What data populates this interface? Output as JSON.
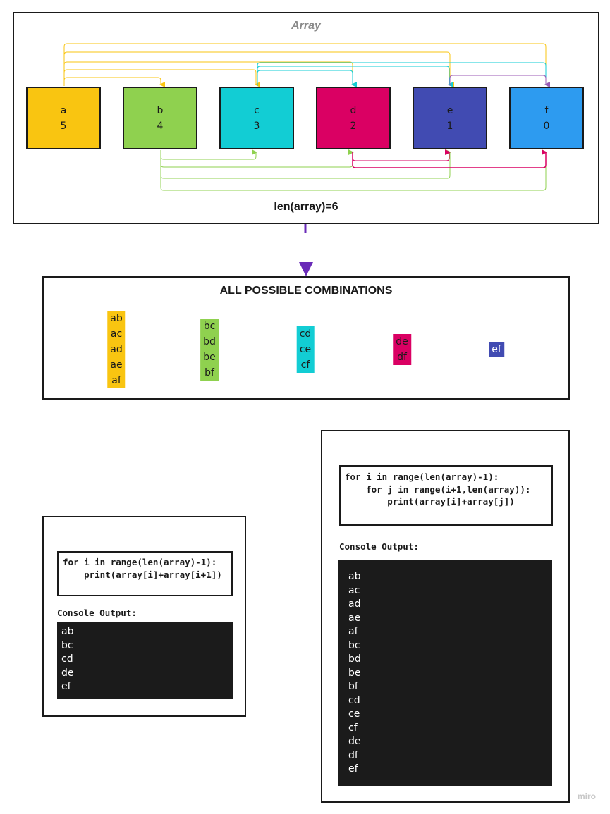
{
  "array_panel": {
    "title": "Array",
    "length_label": "len(array)=6",
    "cells": [
      {
        "letter": "a",
        "value": "5",
        "color": "#f9c511"
      },
      {
        "letter": "b",
        "value": "4",
        "color": "#8fd14f"
      },
      {
        "letter": "c",
        "value": "3",
        "color": "#12cdd4"
      },
      {
        "letter": "d",
        "value": "2",
        "color": "#da0063"
      },
      {
        "letter": "e",
        "value": "1",
        "color": "#414bb2"
      },
      {
        "letter": "f",
        "value": "0",
        "color": "#2d9bf0"
      }
    ],
    "arrow_colors": {
      "a": "#f9c511",
      "b": "#8fd14f",
      "c": "#12cdd4",
      "d": "#da0063",
      "e": "#9b59b6"
    }
  },
  "combinations_panel": {
    "title": "ALL POSSIBLE COMBINATIONS",
    "groups": [
      {
        "color": "#f9c511",
        "items": [
          "ab",
          "ac",
          "ad",
          "ae",
          "af"
        ]
      },
      {
        "color": "#8fd14f",
        "items": [
          "bc",
          "bd",
          "be",
          "bf"
        ]
      },
      {
        "color": "#12cdd4",
        "items": [
          "cd",
          "ce",
          "cf"
        ]
      },
      {
        "color": "#da0063",
        "items": [
          "de",
          "df"
        ]
      },
      {
        "color": "#414bb2",
        "items": [
          "ef"
        ]
      }
    ]
  },
  "connector_color": "#6a2bb8",
  "single_loop": {
    "code": "for i in range(len(array)-1):\n    print(array[i]+array[i+1])",
    "console_label": "Console Output:",
    "output": [
      "ab",
      "bc",
      "cd",
      "de",
      "ef"
    ]
  },
  "nested_loop": {
    "code": "for i in range(len(array)-1):\n    for j in range(i+1,len(array)):\n        print(array[i]+array[j])",
    "console_label": "Console Output:",
    "output": [
      "ab",
      "ac",
      "ad",
      "ae",
      "af",
      "bc",
      "bd",
      "be",
      "bf",
      "cd",
      "ce",
      "cf",
      "de",
      "df",
      "ef"
    ]
  },
  "watermark": "miro"
}
